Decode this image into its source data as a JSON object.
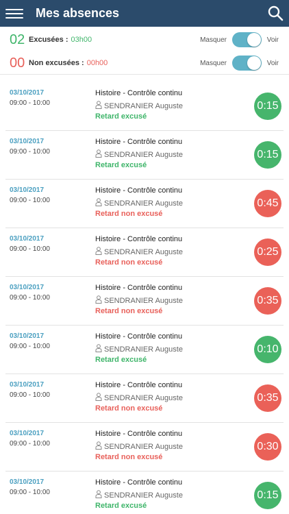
{
  "header": {
    "title": "Mes absences"
  },
  "summary": {
    "excused": {
      "count": "02",
      "label": "Excusées :",
      "value": "03h00"
    },
    "unexcused": {
      "count": "00",
      "label": "Non excusées :",
      "value": "00h00"
    },
    "hide_label": "Masquer",
    "show_label": "Voir"
  },
  "colors": {
    "header": "#2b4b6b",
    "green": "#46b56c",
    "red": "#ea6158",
    "accent": "#5fb2c7"
  },
  "rows": [
    {
      "date": "03/10/2017",
      "time": "09:00 - 10:00",
      "course": "Histoire - Contrôle continu",
      "teacher": "SENDRANIER Auguste",
      "status": "Retard excusé",
      "duration": "0:15",
      "kind": "excused"
    },
    {
      "date": "03/10/2017",
      "time": "09:00 - 10:00",
      "course": "Histoire - Contrôle continu",
      "teacher": "SENDRANIER Auguste",
      "status": "Retard excusé",
      "duration": "0:15",
      "kind": "excused"
    },
    {
      "date": "03/10/2017",
      "time": "09:00 - 10:00",
      "course": "Histoire - Contrôle continu",
      "teacher": "SENDRANIER Auguste",
      "status": "Retard non excusé",
      "duration": "0:45",
      "kind": "unexcused"
    },
    {
      "date": "03/10/2017",
      "time": "09:00 - 10:00",
      "course": "Histoire - Contrôle continu",
      "teacher": "SENDRANIER Auguste",
      "status": "Retard non excusé",
      "duration": "0:25",
      "kind": "unexcused"
    },
    {
      "date": "03/10/2017",
      "time": "09:00 - 10:00",
      "course": "Histoire - Contrôle continu",
      "teacher": "SENDRANIER Auguste",
      "status": "Retard non excusé",
      "duration": "0:35",
      "kind": "unexcused"
    },
    {
      "date": "03/10/2017",
      "time": "09:00 - 10:00",
      "course": "Histoire - Contrôle continu",
      "teacher": "SENDRANIER Auguste",
      "status": "Retard excusé",
      "duration": "0:10",
      "kind": "excused"
    },
    {
      "date": "03/10/2017",
      "time": "09:00 - 10:00",
      "course": "Histoire - Contrôle continu",
      "teacher": "SENDRANIER Auguste",
      "status": "Retard non excusé",
      "duration": "0:35",
      "kind": "unexcused"
    },
    {
      "date": "03/10/2017",
      "time": "09:00 - 10:00",
      "course": "Histoire - Contrôle continu",
      "teacher": "SENDRANIER Auguste",
      "status": "Retard non excusé",
      "duration": "0:30",
      "kind": "unexcused"
    },
    {
      "date": "03/10/2017",
      "time": "09:00 - 10:00",
      "course": "Histoire - Contrôle continu",
      "teacher": "SENDRANIER Auguste",
      "status": "Retard excusé",
      "duration": "0:15",
      "kind": "excused"
    }
  ]
}
